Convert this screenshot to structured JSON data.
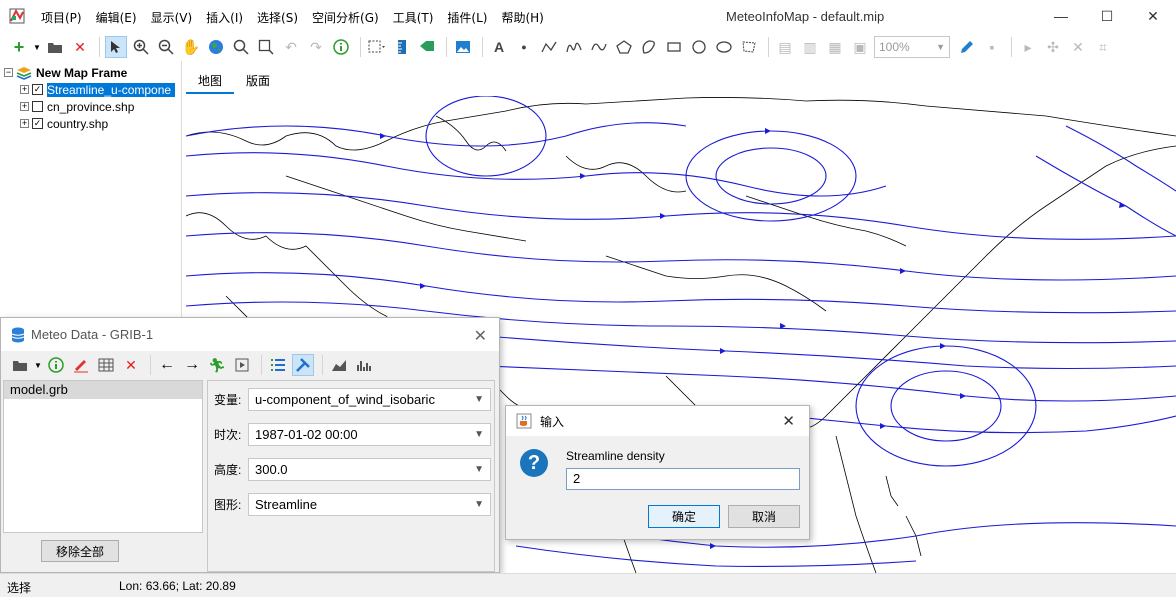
{
  "app": {
    "title": "MeteoInfoMap - default.mip",
    "menu": [
      "项目(P)",
      "编辑(E)",
      "显示(V)",
      "插入(I)",
      "选择(S)",
      "空间分析(G)",
      "工具(T)",
      "插件(L)",
      "帮助(H)"
    ],
    "window_controls": {
      "minimize": "—",
      "maximize": "☐",
      "close": "✕"
    }
  },
  "toolbar": {
    "zoom_value": "100%",
    "icons": [
      "add-layer-icon",
      "open-folder-icon",
      "remove-layer-icon",
      "select-arrow-icon",
      "zoom-in-icon",
      "zoom-out-icon",
      "pan-hand-icon",
      "full-extent-globe-icon",
      "magnifier-icon",
      "zoom-rect-icon",
      "undo-icon",
      "redo-icon",
      "identify-icon",
      "select-features-icon",
      "measure-icon",
      "label-tag-icon",
      "image-icon",
      "text-icon",
      "point-icon",
      "polyline-icon",
      "freehand-icon",
      "curve-icon",
      "polygon-icon",
      "curve-polygon-icon",
      "rectangle-icon",
      "circle-icon",
      "ellipse-icon",
      "edit-vertices-icon"
    ]
  },
  "legend": {
    "frame": "New Map Frame",
    "layers": [
      {
        "name": "Streamline_u-compone",
        "checked": true,
        "selected": true
      },
      {
        "name": "cn_province.shp",
        "checked": false,
        "selected": false
      },
      {
        "name": "country.shp",
        "checked": true,
        "selected": false
      }
    ]
  },
  "tabs": [
    "地图",
    "版面"
  ],
  "status": {
    "mode": "选择",
    "coords": "Lon: 63.66; Lat: 20.89"
  },
  "meteo_dialog": {
    "title": "Meteo Data - GRIB-1",
    "files": [
      "model.grb"
    ],
    "remove_all": "移除全部",
    "params": [
      {
        "label": "变量:",
        "value": "u-component_of_wind_isobaric"
      },
      {
        "label": "时次:",
        "value": "1987-01-02 00:00"
      },
      {
        "label": "高度:",
        "value": "300.0"
      },
      {
        "label": "图形:",
        "value": "Streamline"
      }
    ]
  },
  "input_dialog": {
    "title": "输入",
    "prompt": "Streamline density",
    "value": "2",
    "ok": "确定",
    "cancel": "取消"
  },
  "colors": {
    "streamline": "#1a1ad8",
    "selection": "#0078d7",
    "coastline": "#000000"
  }
}
